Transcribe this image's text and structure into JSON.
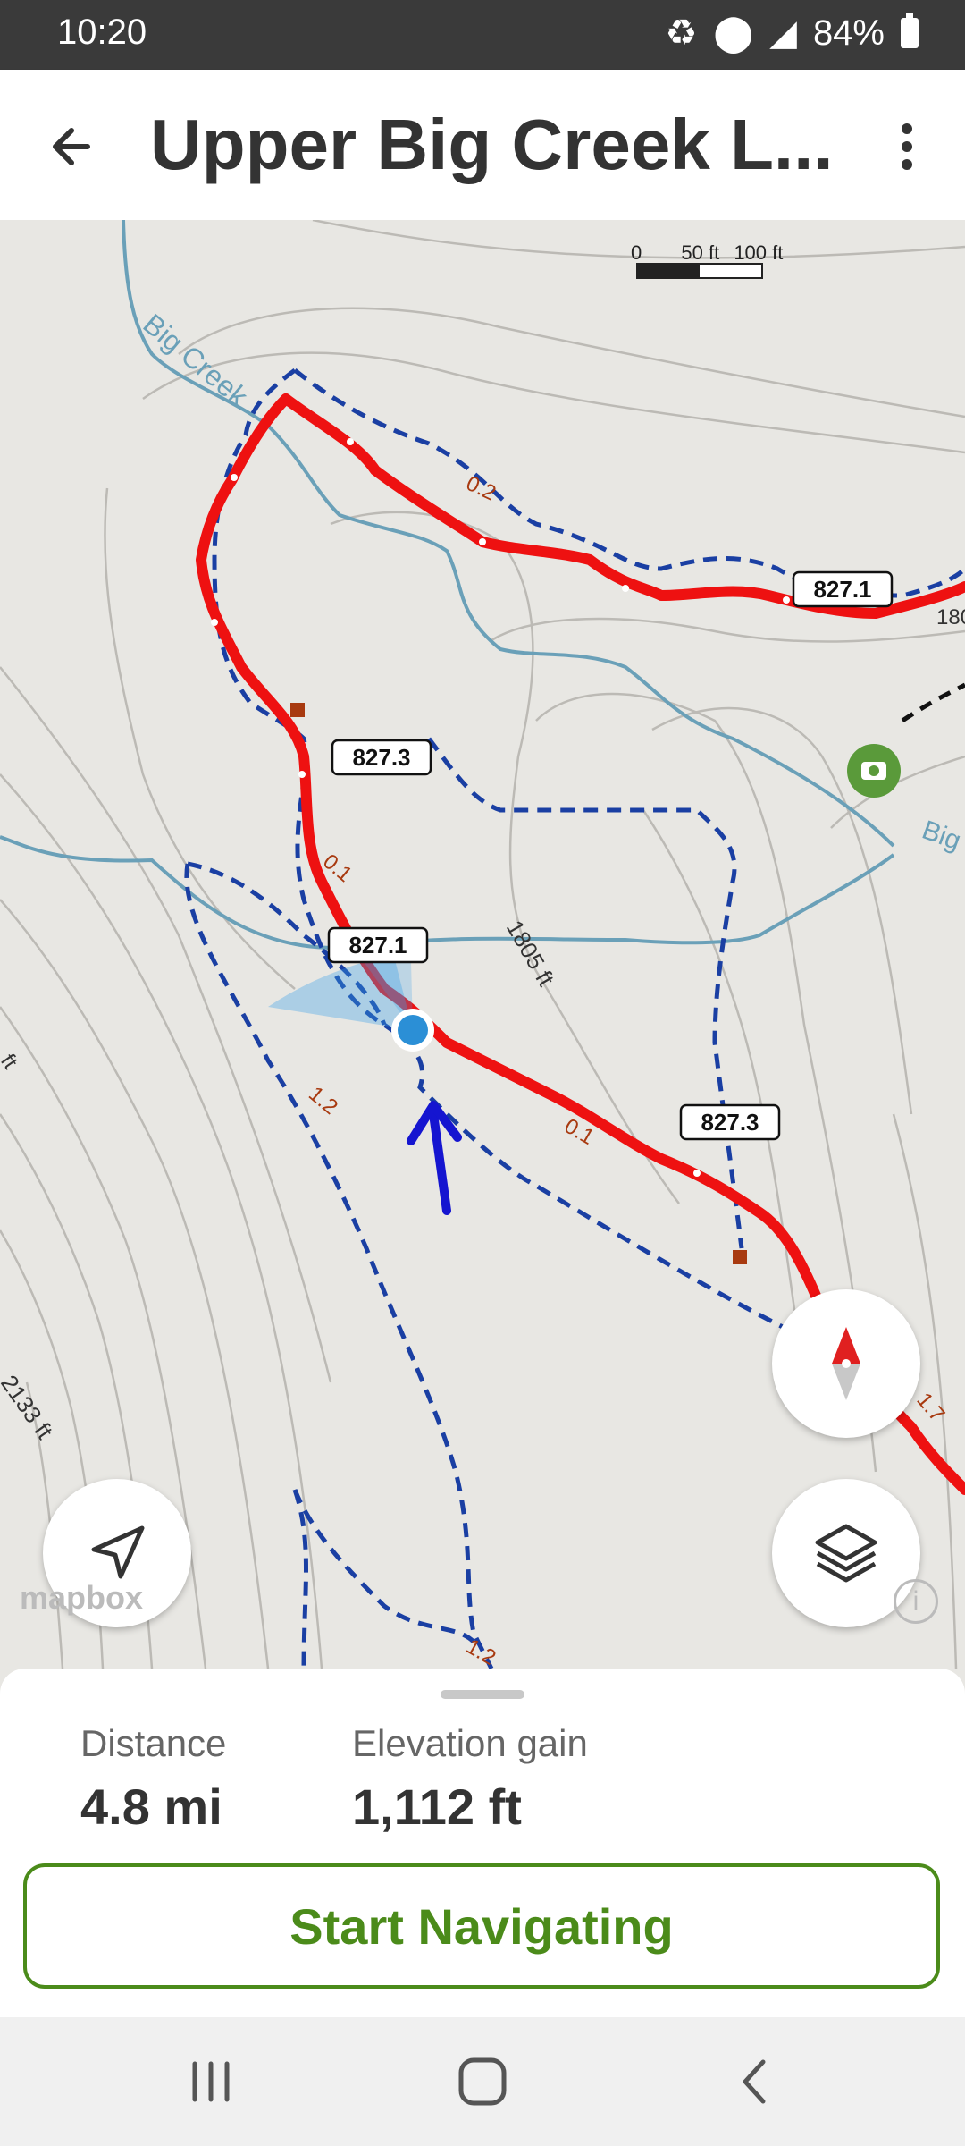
{
  "status_bar": {
    "time": "10:20",
    "battery": "84%"
  },
  "header": {
    "title": "Upper Big Creek L...",
    "back_icon": "arrow-left-icon",
    "more_icon": "more-vertical-icon"
  },
  "map": {
    "scale": {
      "zero": "0",
      "mid": "50 ft",
      "max": "100 ft"
    },
    "labels": {
      "creek_1": "Big Creek",
      "creek_2": "Big",
      "elev_1805": "1805 ft",
      "elev_2133": "2133 ft",
      "elev_180": "180",
      "elev_ft_left": "ft"
    },
    "trail_badges": [
      "827.1",
      "827.3",
      "827.1",
      "827.3"
    ],
    "mile_markers": [
      "0.2",
      "0.1",
      "1.2",
      "0.1",
      "1.7",
      "1.2"
    ],
    "colors": {
      "route": "#ee1111",
      "trail_dashed": "#1a3fa3",
      "creek": "#6aa0b8",
      "accent_green": "#4b8b1a",
      "arrow": "#1515d0"
    },
    "buttons": {
      "compass_icon": "compass-icon",
      "locate_icon": "navigation-arrow-icon",
      "layers_icon": "layers-icon",
      "photo_icon": "camera-icon"
    },
    "attribution": {
      "logo": "mapbox",
      "info_icon": "info-icon"
    }
  },
  "stats": {
    "distance_label": "Distance",
    "distance_value": "4.8 mi",
    "elevation_label": "Elevation gain",
    "elevation_value": "1,112 ft"
  },
  "cta": {
    "label": "Start Navigating"
  },
  "nav_bar": {
    "recent_icon": "recent-apps-icon",
    "home_icon": "home-icon",
    "back_icon": "back-chevron-icon"
  }
}
